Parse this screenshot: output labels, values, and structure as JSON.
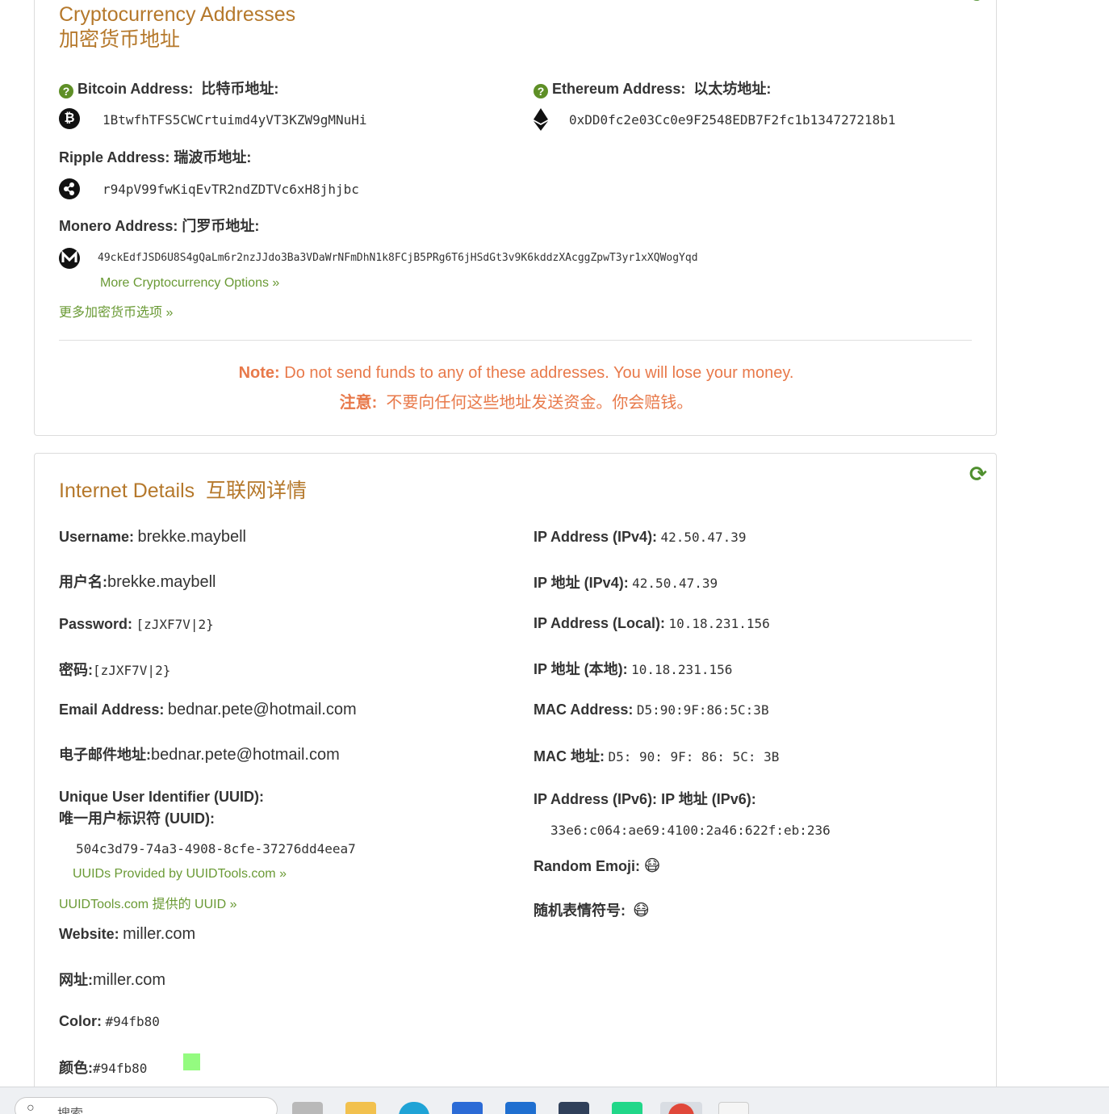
{
  "crypto": {
    "title_en": "Cryptocurrency Addresses",
    "title_zh": "加密货币地址",
    "bitcoin": {
      "label": "Bitcoin Address:",
      "label_zh": "比特币地址:",
      "address": "1BtwfhTFS5CWCrtuimd4yVT3KZW9gMNuHi",
      "icon": "bitcoin-icon"
    },
    "ethereum": {
      "label": "Ethereum Address:",
      "label_zh": "以太坊地址:",
      "address": "0xDD0fc2e03Cc0e9F2548EDB7F2fc1b134727218b1",
      "icon": "ethereum-icon"
    },
    "ripple": {
      "label": "Ripple Address:",
      "label_zh": "瑞波币地址:",
      "address": "r94pV99fwKiqEvTR2ndZDTVc6xH8jhjbc",
      "icon": "ripple-icon"
    },
    "monero": {
      "label": "Monero Address:",
      "label_zh": "门罗币地址:",
      "address": "49ckEdfJSD6U8S4gQaLm6r2nzJJdo3Ba3VDaWrNFmDhN1k8FCjB5PRg6T6jHSdGt3v9K6kddzXAcggZpwT3yr1xXQWogYqd",
      "icon": "monero-icon"
    },
    "more_link_en": "More Cryptocurrency Options »",
    "more_link_zh": "更多加密货币选项 »",
    "note_label_en": "Note:",
    "note_text_en": "Do not send funds to any of these addresses. You will lose your money.",
    "note_label_zh": "注意:",
    "note_text_zh": "不要向任何这些地址发送资金。你会赔钱。"
  },
  "internet": {
    "title_en": "Internet Details",
    "title_zh": "互联网详情",
    "left": {
      "username_label": "Username:",
      "username": "brekke.maybell",
      "username_label_zh": "用户名:",
      "username_zh": "brekke.maybell",
      "password_label": "Password:",
      "password": "[zJXF7V|2}",
      "password_label_zh": "密码:",
      "password_zh": "[zJXF7V|2}",
      "email_label": "Email Address:",
      "email": "bednar.pete@hotmail.com",
      "email_label_zh": "电子邮件地址:",
      "email_zh": "bednar.pete@hotmail.com",
      "uuid_label": "Unique User Identifier (UUID):",
      "uuid_label_zh": "唯一用户标识符 (UUID):",
      "uuid": "504c3d79-74a3-4908-8cfe-37276dd4eea7",
      "uuid_link_en": "UUIDs Provided by UUIDTools.com »",
      "uuid_link_zh": "UUIDTools.com 提供的 UUID »",
      "website_label": "Website:",
      "website": "miller.com",
      "website_label_zh": "网址:",
      "website_zh": "miller.com",
      "color_label": "Color:",
      "color": "#94fb80",
      "color_label_zh": "颜色:",
      "color_zh": "#94fb80"
    },
    "right": {
      "ipv4_label": "IP Address (IPv4):",
      "ipv4": "42.50.47.39",
      "ipv4_label_zh": "IP 地址 (IPv4):",
      "ipv4_zh": "42.50.47.39",
      "local_label": "IP Address (Local):",
      "local": "10.18.231.156",
      "local_label_zh": "IP 地址 (本地):",
      "local_zh": "10.18.231.156",
      "mac_label": "MAC Address:",
      "mac": "D5:90:9F:86:5C:3B",
      "mac_label_zh": "MAC 地址:",
      "mac_zh": "D5: 90: 9F: 86: 5C: 3B",
      "ipv6_label": "IP Address (IPv6):",
      "ipv6_label_zh": "IP 地址 (IPv6):",
      "ipv6": "33e6:c064:ae69:4100:2a46:622f:eb:236",
      "emoji_label": "Random Emoji:",
      "emoji": "😷",
      "emoji_label_zh": "随机表情符号:",
      "emoji_zh": "😷"
    }
  },
  "taskbar": {
    "search_placeholder": "搜索"
  },
  "colors": {
    "heading": "#b5782b",
    "link": "#6a9a35",
    "note": "#e8794a",
    "icon_green": "#5e8f26",
    "swatch": "#94fb80"
  }
}
